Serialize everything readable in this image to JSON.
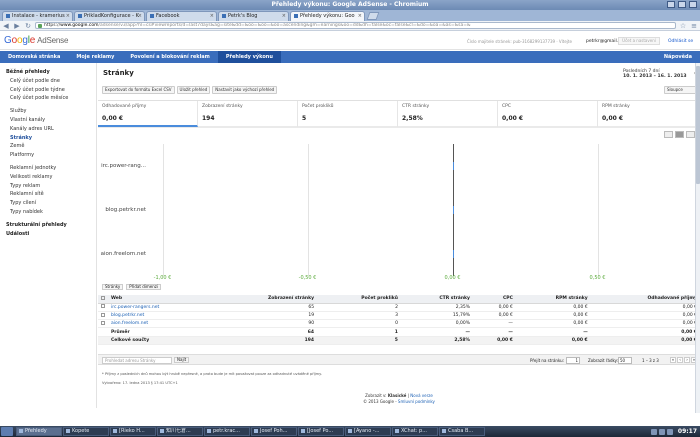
{
  "window": {
    "title": "Přehledy výkonu: Google AdSense - Chromium"
  },
  "tabs": [
    {
      "label": "Instalace - kramerius",
      "active": false
    },
    {
      "label": "PrikladKonfigurace - K",
      "active": false
    },
    {
      "label": "Facebook",
      "active": false
    },
    {
      "label": "Petrk's Blog",
      "active": false
    },
    {
      "label": "Přehledy výkonu: Goo",
      "active": true
    }
  ],
  "url": {
    "scheme": "https://",
    "host": "www.google.com",
    "path": "/adsense/v3/app?hl=cs#viewreports/d=last7days&ag=site&dd=&oo=&oo=&oo=ascending&gm=earnings&oo=dd&dh=false&oc=false&cl=&do=&oa=&as=&sa=&"
  },
  "header": {
    "logo_google": [
      "G",
      "o",
      "o",
      "g",
      "l",
      "e"
    ],
    "logo_product": "AdSense",
    "publisher_id": "Číslo majitele stránek: pub-3168299137739 · Vítejte",
    "email": "petrkr@gmail.com",
    "settings_label": "Účet a nastavení",
    "signout_label": "Odhlásit se"
  },
  "topnav": {
    "items": [
      "Domovská stránka",
      "Moje reklamy",
      "Povolení a blokování reklam",
      "Přehledy výkonu"
    ],
    "active_index": 3,
    "help": "Nápověda"
  },
  "sidebar": {
    "sections": [
      {
        "heading": "Běžné přehledy",
        "items": [
          "Celý účet podle dne",
          "Celý účet podle týdne",
          "Celý účet podle měsíce"
        ]
      },
      {
        "heading": "",
        "items": [
          "Služby",
          "Vlastní kanály",
          "Kanály adres URL",
          "Stránky",
          "Země",
          "Platformy"
        ]
      },
      {
        "heading": "",
        "items": [
          "Reklamní jednotky",
          "Velikosti reklamy",
          "Typy reklam",
          "Reklamní sítě",
          "Typy cílení",
          "Typy nabídek"
        ]
      },
      {
        "heading": "Strukturální přehledy",
        "items": []
      },
      {
        "heading": "Události",
        "items": []
      }
    ],
    "active_item": "Stránky"
  },
  "page": {
    "title": "Stránky",
    "date_label": "Posledních 7 dní",
    "date_range": "10. 1. 2013 – 16. 1. 2013",
    "buttons": [
      "Exportovat do formátu Excel CSV",
      "Uložit přehled",
      "Nastavit jako výchozí přehled"
    ],
    "share_label": "Sloupce"
  },
  "metrics": [
    {
      "label": "Odhadované příjmy",
      "value": "0,00 €",
      "selected": true
    },
    {
      "label": "Zobrazení stránky",
      "value": "194",
      "selected": false
    },
    {
      "label": "Počet prokliků",
      "value": "5",
      "selected": false
    },
    {
      "label": "CTR stránky",
      "value": "2,58%",
      "selected": false
    },
    {
      "label": "CPC",
      "value": "0,00 €",
      "selected": false
    },
    {
      "label": "RPM stránky",
      "value": "0,00 €",
      "selected": false
    }
  ],
  "chart_data": {
    "type": "bar",
    "orientation": "horizontal",
    "categories": [
      "irc.power-rang...",
      "blog.petrkr.net",
      "aion.freelom.net"
    ],
    "values": [
      0,
      0,
      0
    ],
    "x_ticks": [
      "-1,00 €",
      "-0,50 €",
      "0,00 €",
      "0,50 €"
    ],
    "x_tick_values": [
      -1.0,
      -0.5,
      0.0,
      0.5
    ],
    "xlim": [
      -1.05,
      0.75
    ],
    "grid": true,
    "series_color": "#4a8cdc",
    "tick_color": "#5aaa3a"
  },
  "table_tools": {
    "left": "Stránky",
    "right": "Přidat dimenzi"
  },
  "table": {
    "columns": [
      "Web",
      "Zobrazení stránky",
      "Počet prokliků",
      "CTR stránky",
      "CPC",
      "RPM stránky",
      "Odhadované příjmy"
    ],
    "rows": [
      [
        "irc.power-rangers.net",
        "65",
        "2",
        "2,35%",
        "0,00 €",
        "0,00 €",
        "0,00 €"
      ],
      [
        "blog.petrkr.net",
        "19",
        "3",
        "15,79%",
        "0,00 €",
        "0,00 €",
        "0,00 €"
      ],
      [
        "aion.freelom.net",
        "90",
        "0",
        "0,00%",
        "—",
        "0,00 €",
        "0,00 €"
      ]
    ],
    "avg": [
      "Průměr",
      "64",
      "1",
      "—",
      "—",
      "—",
      "0,00 €"
    ],
    "total": [
      "Celkové součty",
      "194",
      "5",
      "2,58%",
      "0,00 €",
      "0,00 €",
      "0,00 €"
    ]
  },
  "pager": {
    "search_placeholder": "Prohledat adresu Stránky",
    "find_label": "Najít",
    "goto_label": "Přejít na stránku:",
    "goto_value": "1",
    "show_rows_label": "Zobrazit řádky:",
    "rows_value": "50",
    "range": "1 – 3 z 3"
  },
  "footnotes": {
    "note": "* Příjmy z posledních dnů mohou být hrubě nepřesné, a proto bude je mít považovat pouze za odhadnuté uváděné příjmy.",
    "updated": "Vytvořeno: 17. ledna 2013 § 17:41 UTC+1"
  },
  "footer": {
    "line1_prefix": "Zobrazit v:",
    "line1_bold": "Klasické",
    "line1_link": "Nová verze",
    "line2": "© 2013 Google -",
    "line2_link": "Smluvní podmínky"
  },
  "taskbar": {
    "items": [
      "Přehledy",
      "Kopete",
      "[Rieko H...",
      "知川七倉...",
      "petr.krac...",
      "Josef Poh...",
      "[Josef Po...",
      "[Ayano -...",
      "XChat: p...",
      "Csaba B..."
    ],
    "active_index": 0,
    "clock": "09:17"
  }
}
